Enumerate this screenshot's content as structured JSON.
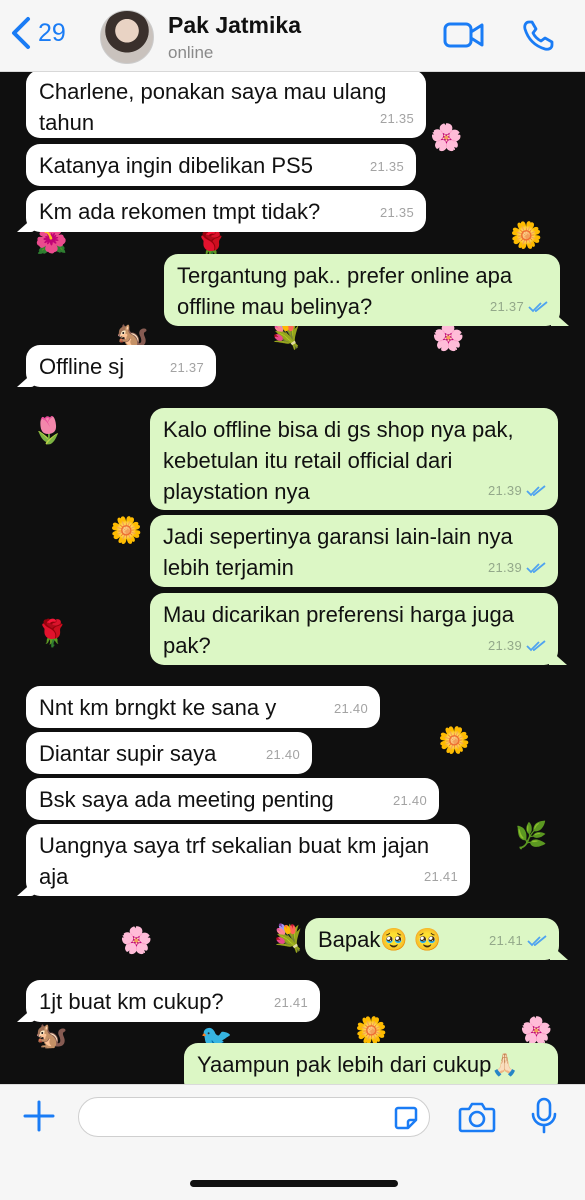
{
  "header": {
    "back_count": "29",
    "contact_name": "Pak Jatmika",
    "status": "online"
  },
  "messages": [
    {
      "dir": "in",
      "text": "Charlene, ponakan saya mau ulang tahun",
      "time": "21.35"
    },
    {
      "dir": "in",
      "text": "Katanya ingin dibelikan PS5",
      "time": "21.35"
    },
    {
      "dir": "in",
      "text": "Km ada rekomen tmpt tidak?",
      "time": "21.35"
    },
    {
      "dir": "out",
      "text": "Tergantung pak.. prefer online apa offline mau belinya?",
      "time": "21.37",
      "read": true
    },
    {
      "dir": "in",
      "text": "Offline sj",
      "time": "21.37"
    },
    {
      "dir": "out",
      "text": "Kalo offline bisa di gs shop nya pak, kebetulan itu retail official dari playstation nya",
      "time": "21.39",
      "read": true
    },
    {
      "dir": "out",
      "text": "Jadi sepertinya garansi lain-lain nya lebih terjamin",
      "time": "21.39",
      "read": true
    },
    {
      "dir": "out",
      "text": "Mau dicarikan preferensi harga juga pak?",
      "time": "21.39",
      "read": true
    },
    {
      "dir": "in",
      "text": "Nnt km brngkt ke sana y",
      "time": "21.40"
    },
    {
      "dir": "in",
      "text": "Diantar supir saya",
      "time": "21.40"
    },
    {
      "dir": "in",
      "text": "Bsk saya ada meeting penting",
      "time": "21.40"
    },
    {
      "dir": "in",
      "text": "Uangnya saya trf sekalian buat km jajan aja",
      "time": "21.41"
    },
    {
      "dir": "out",
      "text": "Bapak🥹 🥹",
      "time": "21.41",
      "read": true
    },
    {
      "dir": "in",
      "text": "1jt buat km cukup?",
      "time": "21.41"
    },
    {
      "dir": "out",
      "text": "Yaampun pak lebih dari cukup🙏🏻",
      "time": "",
      "read": false
    }
  ],
  "input": {
    "placeholder": ""
  },
  "colors": {
    "accent": "#1a7cf5",
    "incoming_bubble": "#ffffff",
    "outgoing_bubble": "#dcf7c5",
    "read_ticks": "#4fa3f0"
  },
  "icons": [
    "chevron-left-icon",
    "video-call-icon",
    "phone-icon",
    "plus-icon",
    "sticker-icon",
    "camera-icon",
    "microphone-icon",
    "double-check-icon"
  ]
}
